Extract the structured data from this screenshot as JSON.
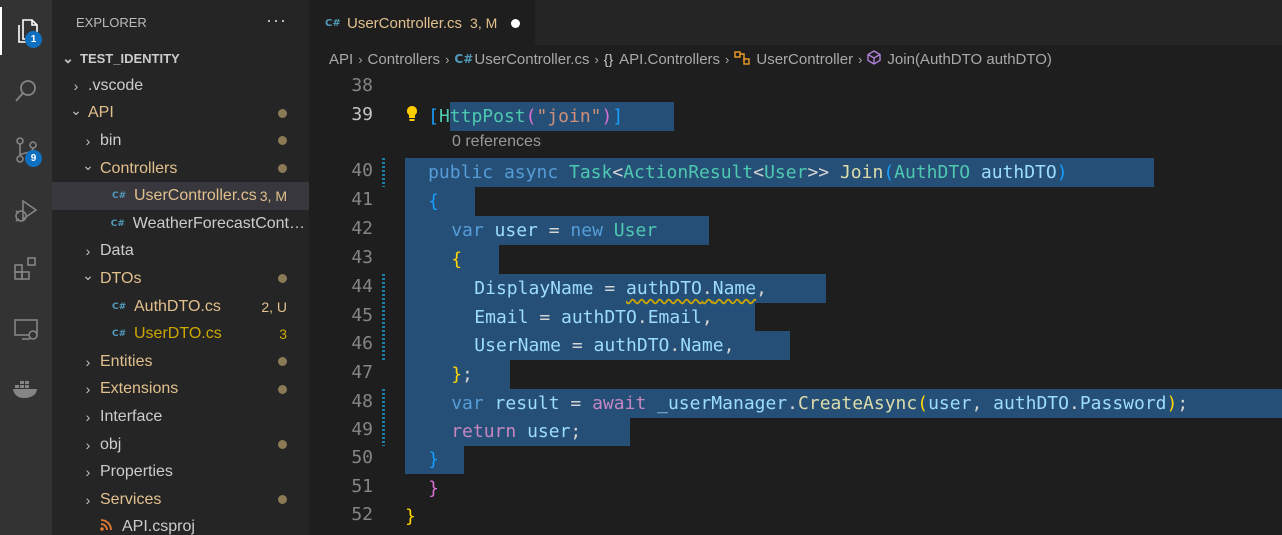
{
  "activity_bar": {
    "items": [
      {
        "name": "explorer",
        "badge": "1"
      },
      {
        "name": "search"
      },
      {
        "name": "source-control",
        "badge": "9"
      },
      {
        "name": "run-debug"
      },
      {
        "name": "extensions"
      },
      {
        "name": "remote-explorer"
      },
      {
        "name": "docker"
      }
    ]
  },
  "sidebar": {
    "title": "EXPLORER",
    "more": "···",
    "root": "TEST_IDENTITY",
    "tree": [
      {
        "label": ".vscode",
        "kind": "folder",
        "expanded": false,
        "depth": 1,
        "color": "normal"
      },
      {
        "label": "API",
        "kind": "folder",
        "expanded": true,
        "depth": 1,
        "color": "modified",
        "dot": true
      },
      {
        "label": "bin",
        "kind": "folder",
        "expanded": false,
        "depth": 2,
        "color": "normal",
        "dot": true
      },
      {
        "label": "Controllers",
        "kind": "folder",
        "expanded": true,
        "depth": 2,
        "color": "modified",
        "dot": true
      },
      {
        "label": "UserController.cs",
        "kind": "cs",
        "depth": 3,
        "color": "modified",
        "status": "3, M",
        "selected": true
      },
      {
        "label": "WeatherForecastControll...",
        "kind": "cs",
        "depth": 3,
        "color": "normal"
      },
      {
        "label": "Data",
        "kind": "folder",
        "expanded": false,
        "depth": 2,
        "color": "normal"
      },
      {
        "label": "DTOs",
        "kind": "folder",
        "expanded": true,
        "depth": 2,
        "color": "modified",
        "dot": true
      },
      {
        "label": "AuthDTO.cs",
        "kind": "cs",
        "depth": 3,
        "color": "modified",
        "status": "2, U"
      },
      {
        "label": "UserDTO.cs",
        "kind": "cs",
        "depth": 3,
        "color": "warning",
        "status": "3"
      },
      {
        "label": "Entities",
        "kind": "folder",
        "expanded": false,
        "depth": 2,
        "color": "modified",
        "dot": true
      },
      {
        "label": "Extensions",
        "kind": "folder",
        "expanded": false,
        "depth": 2,
        "color": "modified",
        "dot": true
      },
      {
        "label": "Interface",
        "kind": "folder",
        "expanded": false,
        "depth": 2,
        "color": "normal"
      },
      {
        "label": "obj",
        "kind": "folder",
        "expanded": false,
        "depth": 2,
        "color": "normal",
        "dot": true
      },
      {
        "label": "Properties",
        "kind": "folder",
        "expanded": false,
        "depth": 2,
        "color": "normal"
      },
      {
        "label": "Services",
        "kind": "folder",
        "expanded": false,
        "depth": 2,
        "color": "modified",
        "dot": true
      },
      {
        "label": "API.csproj",
        "kind": "rss",
        "depth": 2,
        "color": "normal"
      }
    ]
  },
  "tab": {
    "icon": "C#",
    "name": "UserController.cs",
    "badge": "3, M"
  },
  "breadcrumb": {
    "items": [
      {
        "label": "API",
        "icon": ""
      },
      {
        "label": "Controllers",
        "icon": ""
      },
      {
        "label": "UserController.cs",
        "icon": "C#"
      },
      {
        "label": "API.Controllers",
        "icon": "{}"
      },
      {
        "label": "UserController",
        "icon": "class"
      },
      {
        "label": "Join(AuthDTO authDTO)",
        "icon": "method"
      }
    ]
  },
  "editor": {
    "references": "0 references",
    "lines": [
      {
        "n": "38",
        "tokens": []
      },
      {
        "n": "39",
        "current": true,
        "indent": 1,
        "tokens": [
          [
            "b3",
            "["
          ],
          [
            "ty",
            "HttpPost"
          ],
          [
            "b2",
            "("
          ],
          [
            "str",
            "\"join\""
          ],
          [
            "b2",
            ")"
          ],
          [
            "b3",
            "]"
          ]
        ]
      },
      {
        "n": "40",
        "indent": 1,
        "tokens": [
          [
            "kw",
            "public"
          ],
          [
            "pl",
            " "
          ],
          [
            "kw",
            "async"
          ],
          [
            "pl",
            " "
          ],
          [
            "ty",
            "Task"
          ],
          [
            "pl",
            "<"
          ],
          [
            "ty",
            "ActionResult"
          ],
          [
            "pl",
            "<"
          ],
          [
            "ty",
            "User"
          ],
          [
            "pl",
            ">> "
          ],
          [
            "fn",
            "Join"
          ],
          [
            "b3",
            "("
          ],
          [
            "ty",
            "AuthDTO"
          ],
          [
            "pl",
            " "
          ],
          [
            "var",
            "authDTO"
          ],
          [
            "b3",
            ")"
          ]
        ]
      },
      {
        "n": "41",
        "indent": 1,
        "tokens": [
          [
            "b3",
            "{"
          ]
        ]
      },
      {
        "n": "42",
        "indent": 2,
        "tokens": [
          [
            "kw",
            "var"
          ],
          [
            "pl",
            " "
          ],
          [
            "var",
            "user"
          ],
          [
            "pl",
            " = "
          ],
          [
            "kw",
            "new"
          ],
          [
            "pl",
            " "
          ],
          [
            "ty",
            "User"
          ]
        ]
      },
      {
        "n": "43",
        "indent": 2,
        "tokens": [
          [
            "b1",
            "{"
          ]
        ]
      },
      {
        "n": "44",
        "indent": 3,
        "tokens": [
          [
            "var",
            "DisplayName"
          ],
          [
            "pl",
            " = "
          ],
          [
            "var",
            "authDTO"
          ],
          [
            "pl",
            "."
          ],
          [
            "var",
            "Name"
          ],
          [
            "pl",
            ","
          ]
        ]
      },
      {
        "n": "45",
        "indent": 3,
        "tokens": [
          [
            "var",
            "Email"
          ],
          [
            "pl",
            " = "
          ],
          [
            "var",
            "authDTO"
          ],
          [
            "pl",
            "."
          ],
          [
            "var",
            "Email"
          ],
          [
            "pl",
            ","
          ]
        ]
      },
      {
        "n": "46",
        "indent": 3,
        "tokens": [
          [
            "var",
            "UserName"
          ],
          [
            "pl",
            " = "
          ],
          [
            "var",
            "authDTO"
          ],
          [
            "pl",
            "."
          ],
          [
            "var",
            "Name"
          ],
          [
            "pl",
            ","
          ]
        ]
      },
      {
        "n": "47",
        "indent": 2,
        "tokens": [
          [
            "b1",
            "}"
          ],
          [
            "pl",
            ";"
          ]
        ]
      },
      {
        "n": "48",
        "indent": 2,
        "tokens": [
          [
            "kw",
            "var"
          ],
          [
            "pl",
            " "
          ],
          [
            "var",
            "result"
          ],
          [
            "pl",
            " = "
          ],
          [
            "ctl",
            "await"
          ],
          [
            "pl",
            " "
          ],
          [
            "var",
            "_userManager"
          ],
          [
            "pl",
            "."
          ],
          [
            "fn",
            "CreateAsync"
          ],
          [
            "b1",
            "("
          ],
          [
            "var",
            "user"
          ],
          [
            "pl",
            ", "
          ],
          [
            "var",
            "authDTO"
          ],
          [
            "pl",
            "."
          ],
          [
            "var",
            "Password"
          ],
          [
            "b1",
            ")"
          ],
          [
            "pl",
            ";"
          ]
        ]
      },
      {
        "n": "49",
        "indent": 2,
        "tokens": [
          [
            "ctl",
            "return"
          ],
          [
            "pl",
            " "
          ],
          [
            "var",
            "user"
          ],
          [
            "pl",
            ";"
          ]
        ]
      },
      {
        "n": "50",
        "indent": 1,
        "tokens": [
          [
            "b3",
            "}"
          ]
        ]
      },
      {
        "n": "51",
        "indent": 1,
        "tokens": [
          [
            "b2",
            "}"
          ]
        ]
      },
      {
        "n": "52",
        "indent": 0,
        "tokens": [
          [
            "b1",
            "}"
          ]
        ]
      }
    ]
  }
}
